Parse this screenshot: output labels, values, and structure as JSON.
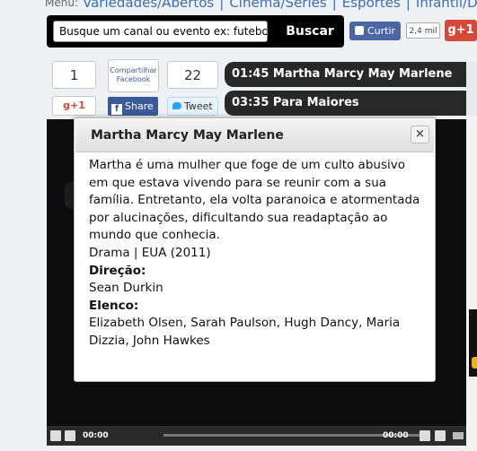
{
  "menu": {
    "label": "Menu:",
    "links": [
      "Variedades/Abertos",
      "Cinema/Séries",
      "Esportes",
      "Infantil/Desenhos"
    ]
  },
  "search": {
    "value": "Busque um canal ou evento ex: futebol",
    "button": "Buscar"
  },
  "social_top": {
    "like_label": "Curtir",
    "like_count": "2,4 mil",
    "gplus_label": "g+1"
  },
  "share": {
    "gplus_count": "1",
    "gplus_label": "g+1",
    "fb_share_caption": "Compartilhar Facebook",
    "fb_share_label": "Share",
    "tweet_count": "22",
    "tweet_label": "Tweet"
  },
  "schedule": [
    {
      "time": "01:45",
      "title": "Martha Marcy May Marlene"
    },
    {
      "time": "03:35",
      "title": "Para Maiores"
    }
  ],
  "modal": {
    "title": "Martha Marcy May Marlene",
    "close_label": "×",
    "synopsis": "Martha é uma mulher que foge de um culto abusivo em que estava vivendo para se reunir com a sua família. Entretanto, ela volta paranoica e atormentada por alucinações, dificultando sua readaptação ao mundo que conhecia.",
    "genre_line": "Drama | EUA (2011)",
    "direction_heading": "Direção:",
    "director": "Sean Durkin",
    "cast_heading": "Elenco:",
    "cast": "Elizabeth Olsen, Sarah Paulson, Hugh Dancy, Maria Dizzia, John Hawkes"
  },
  "player": {
    "current_time": "00:00",
    "duration": "00:00"
  },
  "colors": {
    "facebook": "#3b5998",
    "gplus": "#d64937",
    "schedule_bg": "#282828"
  }
}
